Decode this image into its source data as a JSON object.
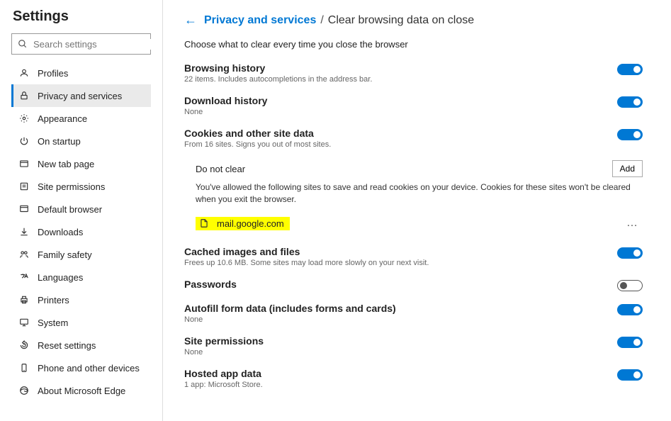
{
  "sidebar": {
    "title": "Settings",
    "search_placeholder": "Search settings",
    "items": [
      {
        "label": "Profiles"
      },
      {
        "label": "Privacy and services"
      },
      {
        "label": "Appearance"
      },
      {
        "label": "On startup"
      },
      {
        "label": "New tab page"
      },
      {
        "label": "Site permissions"
      },
      {
        "label": "Default browser"
      },
      {
        "label": "Downloads"
      },
      {
        "label": "Family safety"
      },
      {
        "label": "Languages"
      },
      {
        "label": "Printers"
      },
      {
        "label": "System"
      },
      {
        "label": "Reset settings"
      },
      {
        "label": "Phone and other devices"
      },
      {
        "label": "About Microsoft Edge"
      }
    ]
  },
  "breadcrumb": {
    "parent": "Privacy and services",
    "current": "Clear browsing data on close"
  },
  "intro": "Choose what to clear every time you close the browser",
  "settings": {
    "browsing_history": {
      "title": "Browsing history",
      "sub": "22 items. Includes autocompletions in the address bar."
    },
    "download_history": {
      "title": "Download history",
      "sub": "None"
    },
    "cookies": {
      "title": "Cookies and other site data",
      "sub": "From 16 sites. Signs you out of most sites."
    },
    "cached": {
      "title": "Cached images and files",
      "sub": "Frees up 10.6 MB. Some sites may load more slowly on your next visit."
    },
    "passwords": {
      "title": "Passwords"
    },
    "autofill": {
      "title": "Autofill form data (includes forms and cards)",
      "sub": "None"
    },
    "site_perms": {
      "title": "Site permissions",
      "sub": "None"
    },
    "hosted": {
      "title": "Hosted app data",
      "sub": "1 app: Microsoft Store."
    }
  },
  "do_not_clear": {
    "title": "Do not clear",
    "add_label": "Add",
    "description": "You've allowed the following sites to save and read cookies on your device. Cookies for these sites won't be cleared when you exit the browser.",
    "site": "mail.google.com"
  }
}
